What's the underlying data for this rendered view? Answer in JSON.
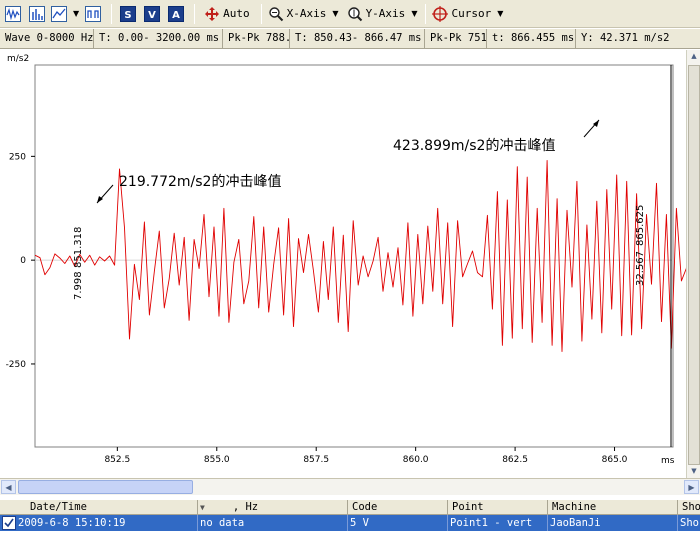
{
  "toolbar": {
    "auto_label": "Auto",
    "xaxis_label": "X-Axis",
    "yaxis_label": "Y-Axis",
    "cursor_label": "Cursor"
  },
  "infobar": {
    "wave_range": "Wave 0-8000 Hz",
    "time_range": "T: 0.00- 3200.00 ms",
    "pkpk_1": "Pk-Pk 788.",
    "cursor_time_range": "T: 850.43- 866.47 ms",
    "pkpk_2": "Pk-Pk 751",
    "cursor_t": "t: 866.455 ms",
    "cursor_y": "Y:   42.371 m/s2"
  },
  "chart_data": {
    "type": "line",
    "ylabel": "m/s2",
    "xunit": "ms",
    "xlim": [
      850.43,
      866.47
    ],
    "ylim": [
      -450,
      470
    ],
    "yticks": [
      250,
      0,
      -250
    ],
    "ytick_labels": [
      "250",
      "0",
      "-250"
    ],
    "xticks": [
      852.5,
      855.0,
      857.5,
      860.0,
      862.5,
      865.0
    ],
    "xtick_labels": [
      "852.5",
      "855.0",
      "857.5",
      "860.0",
      "862.5",
      "865.0"
    ],
    "grid": false,
    "series_color": "#e00000",
    "series": [
      {
        "x_start": 850.43,
        "dx": 0.125,
        "values": [
          12,
          6,
          -35,
          -18,
          15,
          5,
          -8,
          10,
          -15,
          14,
          -5,
          12,
          -12,
          8,
          -2,
          10,
          -12,
          219.772,
          78,
          -190,
          -10,
          -95,
          92,
          -132,
          -28,
          70,
          -115,
          -45,
          65,
          -60,
          55,
          -145,
          50,
          -20,
          110,
          -88,
          80,
          -135,
          125,
          -150,
          -5,
          50,
          -105,
          -50,
          105,
          -115,
          80,
          -125,
          -10,
          78,
          -132,
          100,
          -160,
          52,
          -30,
          62,
          -25,
          -125,
          45,
          -95,
          80,
          -150,
          60,
          -172,
          95,
          -60,
          10,
          -40,
          -2,
          55,
          -75,
          18,
          -65,
          30,
          -108,
          90,
          -135,
          62,
          -105,
          82,
          -75,
          125,
          -105,
          90,
          -160,
          95,
          -40,
          -8,
          22,
          -30,
          -40,
          108,
          -118,
          165,
          -205,
          145,
          -188,
          225,
          -165,
          200,
          -198,
          125,
          -150,
          240,
          -205,
          148,
          -220,
          120,
          -65,
          190,
          -195,
          85,
          -142,
          142,
          -175,
          170,
          -118,
          205,
          -182,
          190,
          -180,
          160,
          -165,
          110,
          -58,
          185,
          -148,
          110,
          -212,
          125,
          -50,
          -20,
          78,
          -120,
          75,
          -162,
          100,
          -45,
          55,
          -25,
          130,
          -125,
          120,
          -105,
          185,
          -148,
          80,
          -115,
          230,
          -150,
          200,
          -212,
          150,
          -235,
          175,
          -185,
          238,
          -175,
          145,
          -182,
          120,
          -50,
          130,
          -40,
          -5,
          62,
          -55,
          -140,
          45,
          -80,
          -2,
          120,
          -210,
          235,
          -110,
          -245,
          162,
          -120,
          225,
          -230,
          280,
          -345,
          423.899,
          -225,
          285,
          -210,
          -45,
          128,
          -70,
          20,
          -90,
          -48,
          75,
          -80,
          120,
          -60,
          75,
          -88,
          15,
          58,
          -85,
          42.371
        ]
      }
    ],
    "annotations": [
      {
        "text": "219.772m/s2的冲击峰值"
      },
      {
        "text": "423.899m/s2的冲击峰值"
      }
    ],
    "cursor1_labels": [
      "851.318",
      "7.998"
    ],
    "cursor2_labels": [
      "865.625",
      "32.567"
    ]
  },
  "table": {
    "headers": [
      "Date/Time",
      ", Hz",
      "Code",
      "Point",
      "Machine",
      "Sho"
    ],
    "row": [
      "2009-6-8 15:10:19",
      "no data",
      "5 V",
      "Point1 - vert",
      "JaoBanJi",
      "Sho"
    ]
  },
  "scroll": {
    "up_arrow": "▲",
    "down_arrow": "▼",
    "left_arrow": "◀",
    "right_arrow": "▶",
    "sort_arrow": "▼",
    "dropdown_arrow": "▼"
  }
}
